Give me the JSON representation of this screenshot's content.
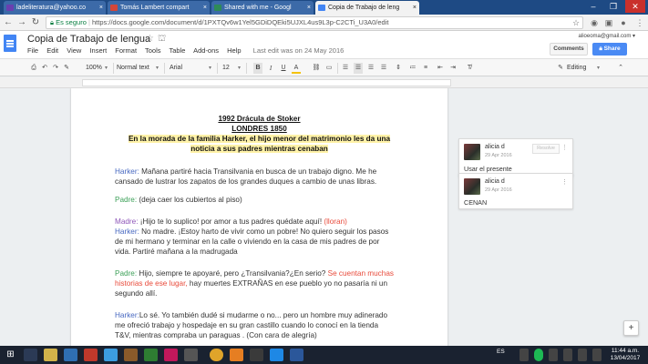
{
  "browser": {
    "tabs": [
      {
        "label": "ladeliteratura@yahoo.co",
        "color": "#6a3fb0"
      },
      {
        "label": "Tomás Lambert compart",
        "color": "#d44638"
      },
      {
        "label": "Shared with me - Googl",
        "color": "#2e8b57"
      },
      {
        "label": "Copia de Trabajo de leng",
        "color": "#4285f4"
      }
    ],
    "secure_label": "Es seguro",
    "url": "https://docs.google.com/document/d/1PXTQv6w1Yel5GDiDQEki5UJXL4us9L3p-C2CTi_U3A0/edit"
  },
  "docs": {
    "title": "Copia de Trabajo de lengua",
    "menu": [
      "File",
      "Edit",
      "View",
      "Insert",
      "Format",
      "Tools",
      "Table",
      "Add-ons",
      "Help"
    ],
    "last_edit": "Last edit was on 24 May 2016",
    "account_email": "alioeoma@gmail.com ▾",
    "comments_label": "Comments",
    "share_label": "Share"
  },
  "toolbar": {
    "zoom": "100%",
    "style": "Normal text",
    "font": "Arial",
    "size": "12",
    "mode": "Editing"
  },
  "document": {
    "heading1": "1992 Drácula de Stoker",
    "heading2": "LONDRES 1850",
    "heading3a": "En la morada de la familia Harker, el hijo menor del matrimonio les da una",
    "heading3b": "noticia a sus padres mientras cenaban",
    "p1_speaker": "Harker:",
    "p1_l1": " Mañana partiré hacia Transilvania en busca de un trabajo digno. Me he",
    "p1_l2": "cansado de lustrar los zapatos de los grandes duques a cambio de unas libras.",
    "p2_speaker": "Padre:",
    "p2_text": " (deja caer los cubiertos al piso)",
    "p3_speaker": "Madre:",
    "p3_text": " ¡Hijo te lo suplico! por amor a tus padres quédate aquí! ",
    "p3_red": "(lloran)",
    "p4_speaker": "Harker:",
    "p4_l1": " No madre. ¡Estoy harto de vivir como un pobre! No quiero seguir los pasos",
    "p4_l2": "de mi hermano y terminar en la calle o viviendo en la casa de mis padres de por",
    "p4_l3": "vida. Partiré mañana a la madrugada",
    "p5_speaker": "Padre:",
    "p5_l1a": " Hijo, siempre te apoyaré, pero ¿Transilvania?¿En serio? ",
    "p5_l1b": "Se cuentan muchas",
    "p5_l2a": "historias de ese lugar,",
    "p5_l2b": " hay  muertes EXTRAÑAS en ese pueblo yo no pasaría ni un",
    "p5_l3": "segundo allí.",
    "p6_speaker": "Harker:",
    "p6_l1": "Lo sé. Yo también dudé si mudarme o no... pero un hombre muy adinerado",
    "p6_l2": "me ofreció trabajo y hospedaje en su gran castillo cuando lo conocí en la tienda",
    "p6_l3": "T&V, mientras compraba un paraguas . (Con cara de alegría)"
  },
  "comments": [
    {
      "author": "alicia d",
      "date": "29 Apr 2016",
      "resolve": "Resolve",
      "text": "Usar el presente"
    },
    {
      "author": "alicia d",
      "date": "29 Apr 2016",
      "text": "CENAN"
    }
  ],
  "taskbar": {
    "lang": "ES",
    "time": "11:44 a.m.",
    "date": "13/04/2017"
  }
}
